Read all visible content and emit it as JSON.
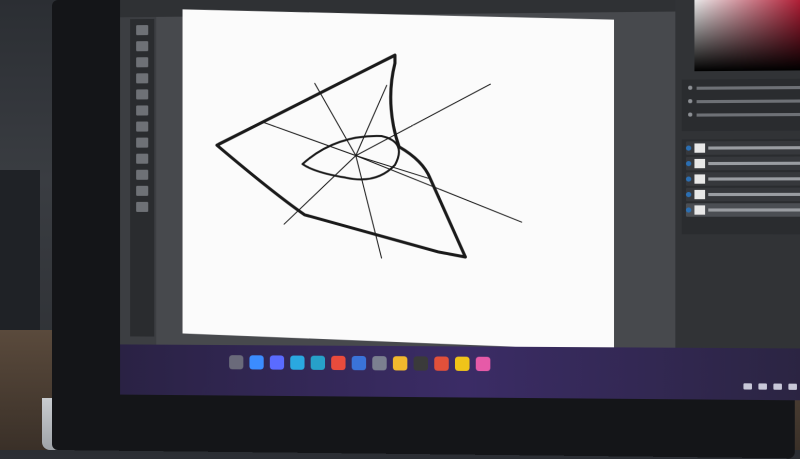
{
  "photoshop": {
    "menu_items": [
      "",
      "",
      "",
      "",
      "",
      ""
    ],
    "canvas": {
      "background": "#fbfbfb"
    }
  },
  "right_panel": {
    "picker_hue": "#c41f3a"
  },
  "taskbar": {
    "icons": [
      {
        "name": "start-icon",
        "color": "#6a6a7a"
      },
      {
        "name": "search-icon",
        "color": "#3b8cff"
      },
      {
        "name": "task-view-icon",
        "color": "#5a6bff"
      },
      {
        "name": "edge-icon",
        "color": "#2aa8e0"
      },
      {
        "name": "photoshop-icon",
        "color": "#27a0c9"
      },
      {
        "name": "store-icon",
        "color": "#e94b3c"
      },
      {
        "name": "mail-icon",
        "color": "#3a73d9"
      },
      {
        "name": "settings-icon",
        "color": "#7b8090"
      },
      {
        "name": "explorer-icon",
        "color": "#f1b82d"
      },
      {
        "name": "terminal-icon",
        "color": "#3a3a3a"
      },
      {
        "name": "office-icon",
        "color": "#e2503a"
      },
      {
        "name": "photos-icon",
        "color": "#f0c419"
      },
      {
        "name": "app-icon",
        "color": "#e65aa8"
      }
    ]
  }
}
